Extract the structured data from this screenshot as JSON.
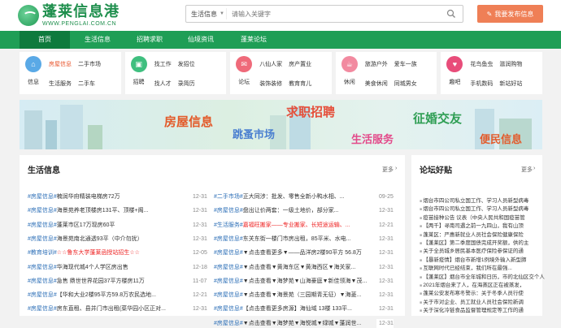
{
  "logo": {
    "cn": "蓬莱信息港",
    "en": "WWW.PENGLAI.COM.CN"
  },
  "search": {
    "category": "生活信息",
    "placeholder": "请输入关键字"
  },
  "post_button": "我要发布信息",
  "nav": [
    "首页",
    "生活信息",
    "招聘求职",
    "仙境资讯",
    "蓬莱论坛"
  ],
  "categories": [
    {
      "name": "信息",
      "color": "#5aa9e6",
      "links": [
        "房屋信息",
        "二手市场",
        "生活服务",
        "二手车"
      ]
    },
    {
      "name": "招聘",
      "color": "#3fbf7f",
      "links": [
        "找工作",
        "发招位",
        "找人才",
        "录简历"
      ]
    },
    {
      "name": "论坛",
      "color": "#ef6a7a",
      "links": [
        "八仙人家",
        "房产置业",
        "装饰装修",
        "教育育儿"
      ]
    },
    {
      "name": "休闲",
      "color": "#f28aa0",
      "links": [
        "旅游户外",
        "爱车一族",
        "美食休闲",
        "同城男女"
      ]
    },
    {
      "name": "趣吧",
      "color": "#e84d7a",
      "links": [
        "花鸟鱼虫",
        "滋润购物",
        "手机数码",
        "新站好站"
      ]
    }
  ],
  "banner": {
    "t1": "房屋信息",
    "t2": "求职招聘",
    "t3": "征婚交友",
    "t4": "跳蚤市场",
    "t5": "生活服务",
    "t6": "便民信息"
  },
  "life": {
    "title": "生活信息",
    "more": "更多",
    "left": [
      {
        "tag": "#房屋信息#",
        "text": "楠润华府精装电梯房72万",
        "date": "12-31"
      },
      {
        "tag": "#房屋信息#",
        "text": "海景苑养老顶楼房131平、顶楼+阁...",
        "date": "12-31"
      },
      {
        "tag": "#房屋信息#",
        "text": "蓬莱市区17万现房60平",
        "date": "12-31"
      },
      {
        "tag": "#房屋信息#",
        "text": "海景苑南北通透93平（中介勿扰）",
        "date": "12-31"
      },
      {
        "tag": "#教育培训#",
        "text": "☆☆鲁东大学蓬莱函授站招生☆☆",
        "date": "12-05",
        "red": true
      },
      {
        "tag": "#房屋信息#",
        "text": "华海现代城4个人学区房出售",
        "date": "12-18"
      },
      {
        "tag": "#房屋信息#",
        "text": "急售 鼎世世界花园37平方楼房11万",
        "date": "11-07"
      },
      {
        "tag": "#房屋信息#",
        "text": "【华和大业2楼95平方59.8万农民选地...",
        "date": "12-21"
      },
      {
        "tag": "#房屋信息#",
        "text": "房东直租、县并门市出租(菜华园小区正对...",
        "date": "12-31"
      }
    ],
    "right": [
      {
        "tag": "#二手市场#",
        "text": "正大同涉：批发、零售全新小鸭水相、...",
        "date": "09-25"
      },
      {
        "tag": "#房屋信息#",
        "text": "盘出让价两套：一级土地价，部分家...",
        "date": "12-31"
      },
      {
        "tag": "#生活服务#",
        "text": "嘉福旺搬家——专业搬家、长短途运输、...",
        "date": "12-21",
        "red": true
      },
      {
        "tag": "#房屋信息#",
        "text": "东关东街一楼门市房出租，85平米、水电...",
        "date": "12-31"
      },
      {
        "tag": "#房屋信息#",
        "text": "▼点击查看更多▼——品洋房2楼90平方 56.8万",
        "date": "12-31"
      },
      {
        "tag": "#房屋信息#",
        "text": "▼点击查看▼黄海东区▼黄海西区▼海关家...",
        "date": "12-31"
      },
      {
        "tag": "#房屋信息#",
        "text": "▼点击查看▼海梦苑▼山海豪庭▼新佳领海▼茂...",
        "date": "12-31"
      },
      {
        "tag": "#房屋信息#",
        "text": "▼点击查看▼海景苑（三园期青无征）▼海菱...",
        "date": "12-31"
      },
      {
        "tag": "#房屋信息#",
        "text": "【点击查看更多房源】海仙域 13楼 133平...",
        "date": "12-31"
      },
      {
        "tag": "#房屋信息#",
        "text": "▼点击查看▼海梦苑▼海悦城▼绿城▼蓬润世...",
        "date": "12-31"
      }
    ]
  },
  "forum": {
    "title": "论坛好贴",
    "more": "更多",
    "items": [
      "烟台市四公司私立国工作、学习人员新型病毒",
      "烟台市四公司私立国工作、学习人员新型病毒",
      "疫苗接种公告 议表（中央人民共和国疫苗管",
      "【两千】寻南司遇之前一九四山，我有山顶",
      "蓬莱区：严惠新就业人员社会保险健康保险",
      "【蓬莱区】第二季度国债完成开奖额，供的主",
      "关于全员城乡居民基本医疗保险参保证的通",
      "【暴新疫情】烟台市新增1例境外输入新型肺",
      "互联网时代已经结束，我们所在最强...",
      "【蓬莱区】烟台市全年城和日历，市的北仙区交个人",
      "2021年烟台来了人，在海蒸区正在被蒸发，",
      "蓬莱公安发布寒冬警示：关于冬季人员行使",
      "关于市对企业、员工就业人员社会保险新调",
      "关于深化冷链食品监督管理规定等工作的通"
    ]
  }
}
